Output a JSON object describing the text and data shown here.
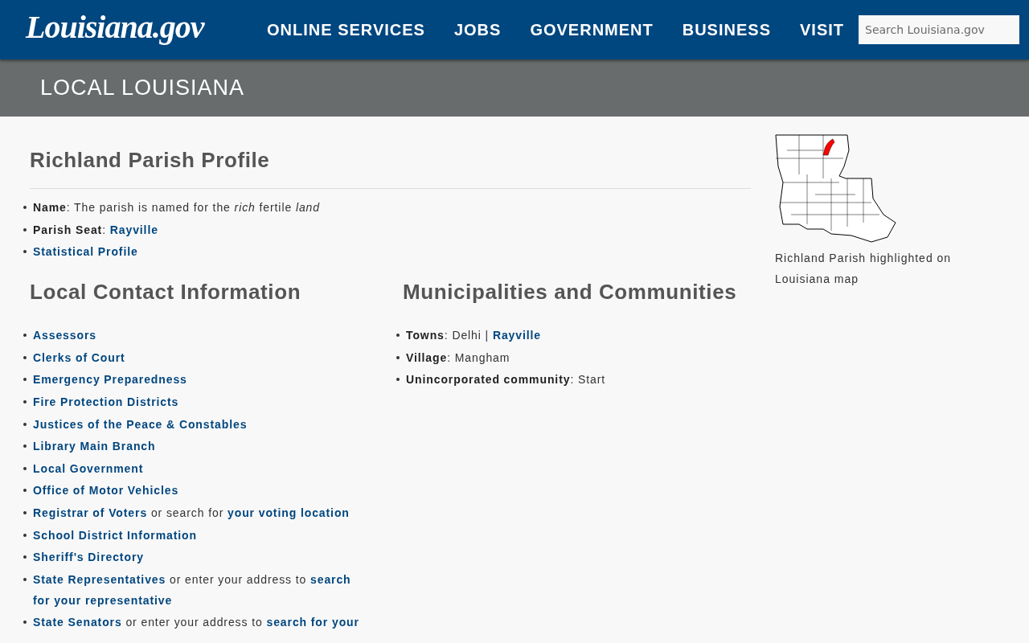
{
  "header": {
    "logo": "Louisiana.gov",
    "nav": [
      "ONLINE SERVICES",
      "JOBS",
      "GOVERNMENT",
      "BUSINESS",
      "VISIT"
    ],
    "search": {
      "placeholder": "Search Louisiana.gov"
    }
  },
  "banner": {
    "title": "LOCAL LOUISIANA"
  },
  "profile": {
    "title": "Richland Parish Profile",
    "items": [
      [
        {
          "kind": "bold",
          "text": "Name"
        },
        {
          "kind": "plain",
          "text": ": The parish is named for the *rich* fertile *land*"
        }
      ],
      [
        {
          "kind": "bold",
          "text": "Parish Seat"
        },
        {
          "kind": "plain",
          "text": ":"
        },
        {
          "kind": "link",
          "text": "Rayville"
        }
      ],
      [
        {
          "kind": "link",
          "text": "Statistical Profile"
        }
      ]
    ]
  },
  "contacts": {
    "title": "Local Contact Information",
    "items": [
      [
        {
          "kind": "link",
          "text": "Assessors"
        }
      ],
      [
        {
          "kind": "link",
          "text": "Clerks of Court"
        }
      ],
      [
        {
          "kind": "link",
          "text": "Emergency Preparedness"
        }
      ],
      [
        {
          "kind": "link",
          "text": "Fire Protection Districts"
        }
      ],
      [
        {
          "kind": "link",
          "text": "Justices of the Peace & Constables"
        }
      ],
      [
        {
          "kind": "link",
          "text": "Library Main Branch"
        }
      ],
      [
        {
          "kind": "link",
          "text": "Local Government"
        }
      ],
      [
        {
          "kind": "link",
          "text": "Office of Motor Vehicles"
        }
      ],
      [
        {
          "kind": "link",
          "text": "Registrar of Voters"
        },
        {
          "kind": "plain",
          "text": "or search for"
        },
        {
          "kind": "link",
          "text": "your voting location"
        }
      ],
      [
        {
          "kind": "link",
          "text": "School District Information"
        }
      ],
      [
        {
          "kind": "link",
          "text": "Sheriff's Directory"
        }
      ],
      [
        {
          "kind": "link",
          "text": "State Representatives"
        },
        {
          "kind": "plain",
          "text": "or enter your address to"
        },
        {
          "kind": "link",
          "text": "search"
        },
        {
          "kind": "link",
          "text": "for your representative"
        }
      ],
      [
        {
          "kind": "link",
          "text": "State Senators"
        },
        {
          "kind": "plain",
          "text": "or enter your address to"
        },
        {
          "kind": "link",
          "text": "search for your"
        }
      ]
    ]
  },
  "municipalities": {
    "title": "Municipalities and Communities",
    "items": [
      [
        {
          "kind": "bold",
          "text": "Towns"
        },
        {
          "kind": "plain",
          "text": ": Delhi |"
        },
        {
          "kind": "link",
          "text": "Rayville"
        }
      ],
      [
        {
          "kind": "bold",
          "text": "Village"
        },
        {
          "kind": "plain",
          "text": ": Mangham"
        }
      ],
      [
        {
          "kind": "bold",
          "text": "Unincorporated community"
        },
        {
          "kind": "plain",
          "text": ": Start"
        }
      ]
    ]
  },
  "map": {
    "caption": "Richland Parish highlighted on Louisiana map"
  }
}
